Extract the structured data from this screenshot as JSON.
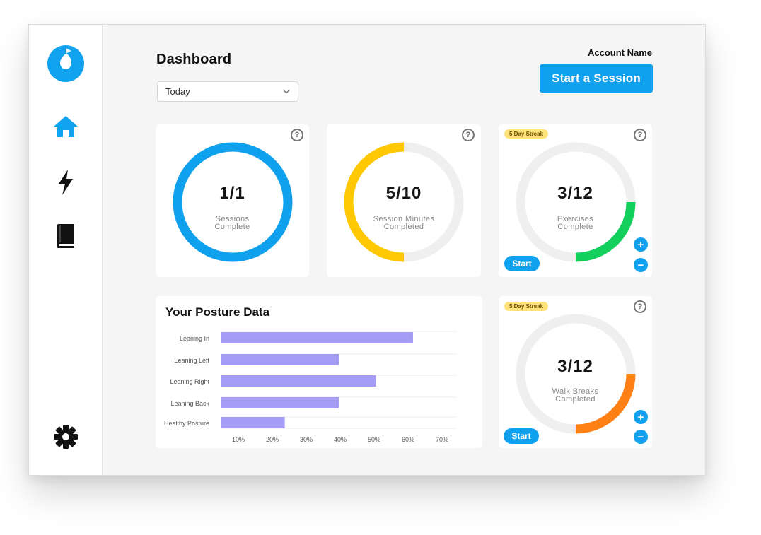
{
  "sidebar": {
    "logo": "app-logo",
    "items": [
      {
        "icon": "home-icon"
      },
      {
        "icon": "lightning-icon"
      },
      {
        "icon": "book-icon"
      }
    ],
    "settings_icon": "gear-icon"
  },
  "header": {
    "title": "Dashboard",
    "account_name": "Account Name",
    "start_session_label": "Start a Session",
    "period_select": {
      "value": "Today"
    }
  },
  "colors": {
    "accent": "#0fa0ee",
    "sessions_ring": "#0fa0ee",
    "minutes_ring": "#ffc800",
    "exercises_ring": "#13cf5c",
    "walk_ring": "#ff8015",
    "track": "#efefef",
    "bars": "#a59df5",
    "streak": "#ffe27a"
  },
  "cards": {
    "sessions": {
      "value": "1/1",
      "label": "Sessions Complete",
      "progress": 1.0
    },
    "minutes": {
      "value": "5/10",
      "label": "Session Minutes Completed",
      "progress": 0.5
    },
    "exercises": {
      "value": "3/12",
      "label": "Exercises Complete",
      "progress": 0.25,
      "streak": "5 Day Streak",
      "start_label": "Start",
      "plus": "+",
      "minus": "−"
    },
    "walk_breaks": {
      "value": "3/12",
      "label": "Walk Breaks Completed",
      "progress": 0.25,
      "streak": "5 Day Streak",
      "start_label": "Start",
      "plus": "+",
      "minus": "−"
    }
  },
  "help_glyph": "?",
  "posture": {
    "title": "Your Posture Data"
  },
  "chart_data": {
    "type": "bar",
    "orientation": "horizontal",
    "categories": [
      "Leaning In",
      "Leaning Left",
      "Leaning Right",
      "Leaning Back",
      "Healthy Posture"
    ],
    "values": [
      57,
      35,
      46,
      35,
      19
    ],
    "xticks": [
      "10%",
      "20%",
      "30%",
      "40%",
      "50%",
      "60%",
      "70%"
    ],
    "xlim": [
      0,
      70
    ],
    "grid": true,
    "title": "Your Posture Data"
  }
}
